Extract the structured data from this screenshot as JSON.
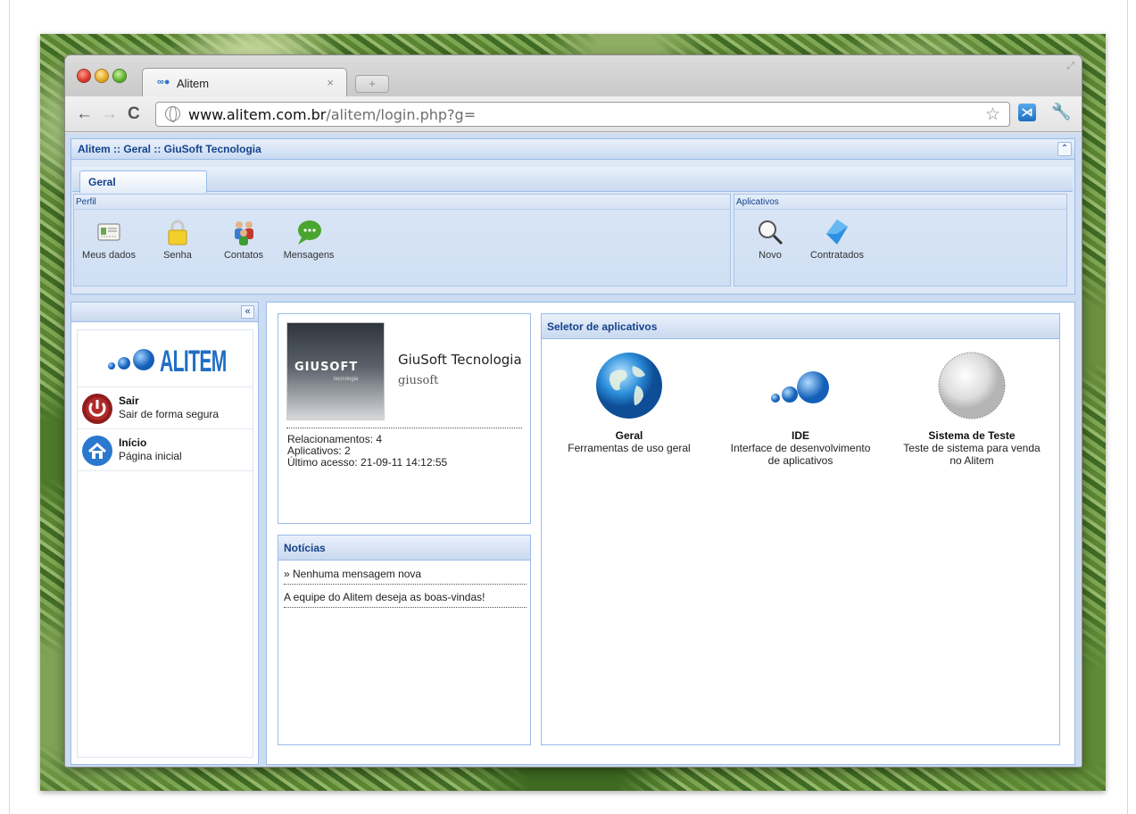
{
  "browser": {
    "tab_title": "Alitem",
    "url_domain": "www.alitem.com.br",
    "url_path": "/alitem/login.php?g="
  },
  "app": {
    "title": "Alitem :: Geral :: GiuSoft Tecnologia",
    "ribbon_tab": "Geral",
    "groups": {
      "perfil": {
        "label": "Perfil",
        "buttons": [
          "Meus dados",
          "Senha",
          "Contatos",
          "Mensagens"
        ]
      },
      "aplicativos": {
        "label": "Aplicativos",
        "buttons": [
          "Novo",
          "Contratados"
        ]
      }
    }
  },
  "sidebar": {
    "brand": "ALITEM",
    "items": [
      {
        "title": "Sair",
        "subtitle": "Sair de forma segura",
        "icon": "power-icon"
      },
      {
        "title": "Início",
        "subtitle": "Página inicial",
        "icon": "home-icon"
      }
    ]
  },
  "profile": {
    "logo_text": "GIUSOFT",
    "logo_sub": "tecnologia",
    "name": "GiuSoft Tecnologia",
    "username": "giusoft",
    "stats": [
      "Relacionamentos: 4",
      "Aplicativos: 2",
      "Último acesso: 21-09-11 14:12:55"
    ]
  },
  "news": {
    "title": "Notícias",
    "items": [
      "» Nenhuma mensagem nova",
      "A equipe do Alitem deseja as boas-vindas!"
    ]
  },
  "selector": {
    "title": "Seletor de aplicativos",
    "apps": [
      {
        "title": "Geral",
        "desc1": "Ferramentas de uso geral",
        "desc2": ""
      },
      {
        "title": "IDE",
        "desc1": "Interface de desenvolvimento",
        "desc2": "de aplicativos"
      },
      {
        "title": "Sistema de Teste",
        "desc1": "Teste de sistema para venda",
        "desc2": "no Alitem"
      }
    ]
  },
  "colors": {
    "accent": "#15428b",
    "border": "#99bbe8",
    "brand": "#1f6fc4"
  }
}
